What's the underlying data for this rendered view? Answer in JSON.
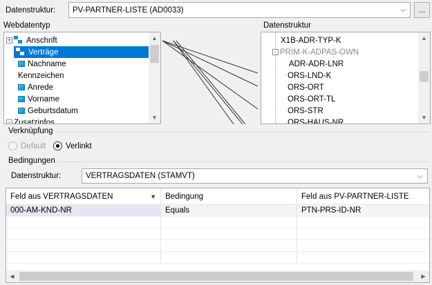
{
  "top": {
    "label": "Datenstruktur:",
    "value": "PV-PARTNER-LISTE (AD0033)",
    "browse_label": "..."
  },
  "left_tree": {
    "title": "Webdatentyp",
    "items": [
      {
        "label": "Anschrift",
        "icon": "group-icon",
        "expander": "+"
      },
      {
        "label": "Verträge",
        "icon": "group-icon",
        "selected": true
      },
      {
        "label": "Nachname",
        "icon": "field-icon"
      },
      {
        "label": "Kennzeichen",
        "icon": ""
      },
      {
        "label": "Anrede",
        "icon": "field-icon"
      },
      {
        "label": "Vorname",
        "icon": "field-icon"
      },
      {
        "label": "Geburtsdatum",
        "icon": "field-icon"
      },
      {
        "label": "Zusatzinfos",
        "icon": "",
        "expander": "-"
      }
    ]
  },
  "right_tree": {
    "title": "Datenstruktur",
    "items": [
      {
        "label": "X1B-ADR-TYP-K"
      },
      {
        "label": "PRIM-K-ADPAS-OWN",
        "muted": true,
        "expander": "-"
      },
      {
        "label": "ADR-ADR-LNR"
      },
      {
        "label": "ORS-LND-K"
      },
      {
        "label": "ORS-ORT"
      },
      {
        "label": "ORS-ORT-TL"
      },
      {
        "label": "ORS-STR"
      },
      {
        "label": "ORS-HAUS-NR"
      }
    ]
  },
  "verknuepfung": {
    "title": "Verknüpfung",
    "options": [
      {
        "label": "Default",
        "checked": false,
        "disabled": true
      },
      {
        "label": "Verlinkt",
        "checked": true,
        "disabled": false
      }
    ]
  },
  "bedingungen": {
    "title": "Bedingungen",
    "struct_label": "Datenstruktur:",
    "struct_value": "VERTRAGSDATEN (STAMVT)",
    "columns": [
      "Feld aus VERTRAGSDATEN",
      "Bedingung",
      "Feld aus PV-PARTNER-LISTE"
    ],
    "rows": [
      [
        "000-AM-KND-NR",
        "Equals",
        "PTN-PRS-ID-NR"
      ]
    ]
  },
  "colors": {
    "selection": "#0078d7",
    "window_bg": "#f0f0f0",
    "border": "#a8a8a8",
    "row_highlight": "#e5e5f3"
  }
}
